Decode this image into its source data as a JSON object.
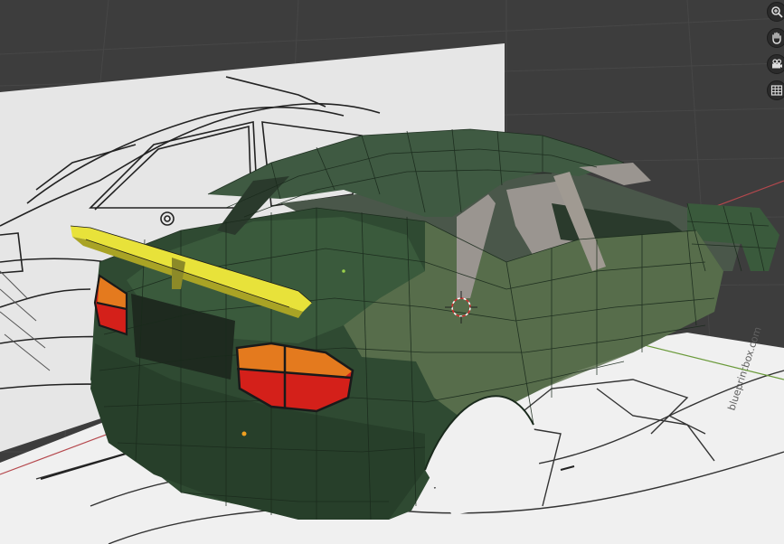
{
  "viewport": {
    "background": "#3d3d3d",
    "grid_color": "#464646",
    "axis_x_color": "#b5484d",
    "axis_y_color": "#6a9a3a"
  },
  "reference_images": {
    "side_view": {
      "paper_color": "#e6e6e6"
    },
    "top_view": {
      "paper_color": "#f0f0f0",
      "watermark": "blueprintbox.com"
    }
  },
  "model": {
    "body_color": "#2f4a32",
    "body_highlight": "#5e7350",
    "wire_color": "#1a2a1c",
    "selected_color": "#e8e23a",
    "taillight_orange": "#e47a1e",
    "taillight_red": "#d4201a",
    "interior_color": "#9a9590"
  },
  "navigation_gizmo": {
    "buttons": [
      {
        "id": "zoom",
        "icon": "zoom-icon"
      },
      {
        "id": "pan",
        "icon": "hand-icon"
      },
      {
        "id": "camera",
        "icon": "camera-icon"
      },
      {
        "id": "ortho",
        "icon": "grid-icon"
      }
    ]
  }
}
